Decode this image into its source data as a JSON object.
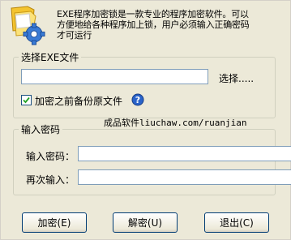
{
  "header": {
    "description_lines": [
      "EXE程序加密锁是一款专业的程序加密软件。可以",
      "方便地给各种程序加上锁，用户必须输入正确密码",
      "才可运行"
    ]
  },
  "file_group": {
    "legend": "选择EXE文件",
    "file_path_value": "",
    "browse_label": "选择.....",
    "backup_label": "加密之前备份原文件",
    "backup_checked": true
  },
  "watermark": "成品软件liuchaw.com/ruanjian",
  "password_group": {
    "legend": "输入密码",
    "password_label": "输入密码：",
    "confirm_label": "再次输入："
  },
  "buttons": {
    "encrypt": "加密(E)",
    "decrypt": "解密(U)",
    "exit": "退出(C)"
  },
  "colors": {
    "background": "#ece9d8",
    "input_border": "#7f9db9",
    "button_border": "#003c74"
  },
  "icons": [
    "folder-gear-logo",
    "checkmark-icon",
    "help-icon"
  ]
}
